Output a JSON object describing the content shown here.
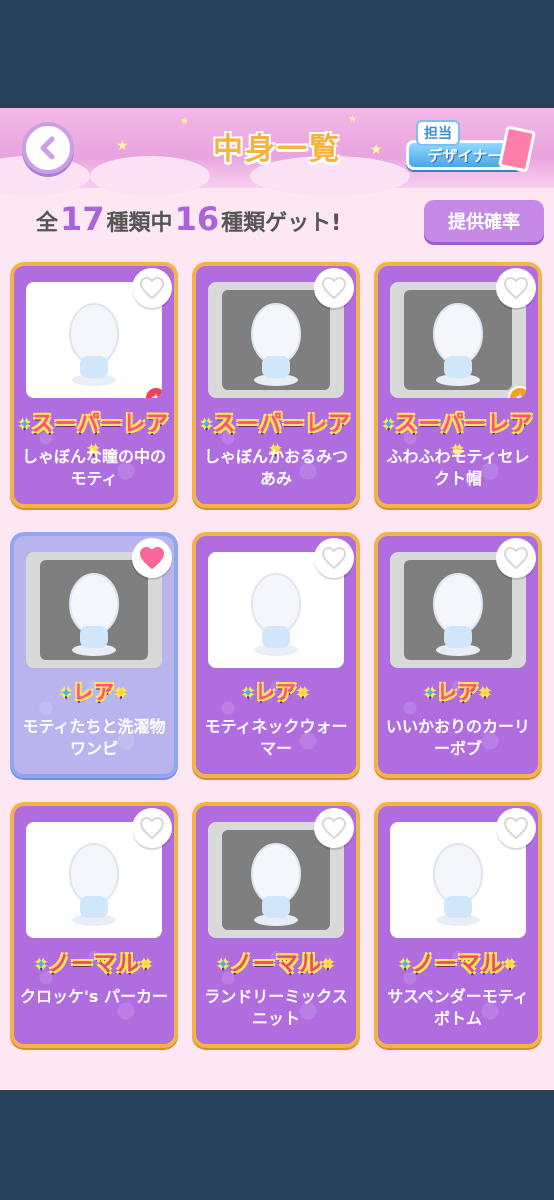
{
  "header": {
    "title": "中身一覧",
    "designer_tag": "担当",
    "designer_label": "デザイナー"
  },
  "summary": {
    "prefix": "全",
    "total": "17",
    "middle": "種類中",
    "obtained": "16",
    "suffix": "種類ゲット!"
  },
  "rate_button": "提供確率",
  "colors": {
    "accent": "#b06de0",
    "card_border": "#f3b24a",
    "owned_card": "#b9b4ee",
    "heart_on": "#f6679a"
  },
  "items": [
    {
      "rarity": "スーパーレア",
      "name": "しゃぼんな瞳の中のモティ",
      "heart": "off",
      "bg": "white",
      "badge": "red"
    },
    {
      "rarity": "スーパーレア",
      "name": "しゃぼんかおるみつあみ",
      "heart": "off",
      "bg": "gray",
      "badge": ""
    },
    {
      "rarity": "スーパーレア",
      "name": "ふわふわモティセレクト帽",
      "heart": "off",
      "bg": "gray",
      "badge": "gold"
    },
    {
      "rarity": "レア",
      "name": "モティたちと洗濯物ワンピ",
      "heart": "on",
      "bg": "gray",
      "badge": ""
    },
    {
      "rarity": "レア",
      "name": "モティネックウォーマー",
      "heart": "off",
      "bg": "white",
      "badge": ""
    },
    {
      "rarity": "レア",
      "name": "いいかおりのカーリーボブ",
      "heart": "off",
      "bg": "gray",
      "badge": ""
    },
    {
      "rarity": "ノーマル",
      "name": "クロッケ's パーカー",
      "heart": "off",
      "bg": "white",
      "badge": ""
    },
    {
      "rarity": "ノーマル",
      "name": "ランドリーミックスニット",
      "heart": "off",
      "bg": "gray",
      "badge": ""
    },
    {
      "rarity": "ノーマル",
      "name": "サスペンダーモティボトム",
      "heart": "off",
      "bg": "white",
      "badge": ""
    }
  ]
}
